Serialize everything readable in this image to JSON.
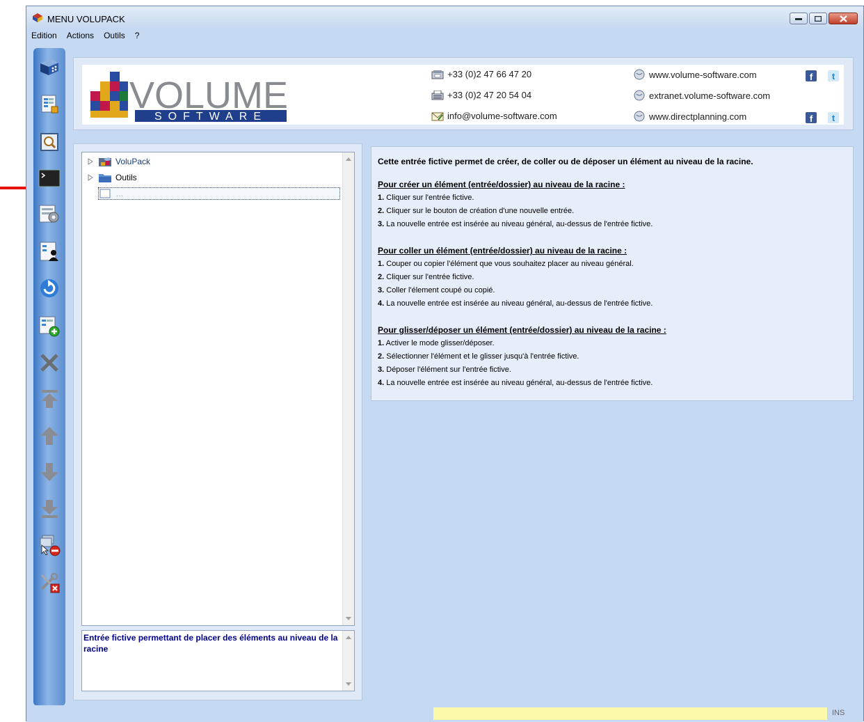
{
  "window": {
    "title": "MENU VOLUPACK"
  },
  "menu": [
    "Edition",
    "Actions",
    "Outils",
    "?"
  ],
  "toolbar_icons": [
    "volupack-icon",
    "form-lock-icon",
    "search-preview-icon",
    "console-icon",
    "settings-panel-icon",
    "user-tree-icon",
    "refresh-icon",
    "add-entry-icon",
    "delete-icon",
    "move-top-icon",
    "move-up-icon",
    "move-down-icon",
    "move-bottom-icon",
    "drag-drop-off-icon",
    "tools-close-icon"
  ],
  "logo": {
    "word": "VOLUME",
    "sub": "SOFTWARE"
  },
  "contacts": {
    "phone": "+33 (0)2 47 66 47 20",
    "fax": "+33 (0)2 47 20 54 04",
    "email": "info@volume-software.com",
    "web1": "www.volume-software.com",
    "web2": "extranet.volume-software.com",
    "web3": "www.directplanning.com"
  },
  "tree": {
    "items": [
      {
        "label": "VoluPack"
      },
      {
        "label": "Outils"
      },
      {
        "label": "..."
      }
    ]
  },
  "description": "Entrée fictive permettant de placer des éléments au niveau de la racine",
  "info": {
    "intro": "Cette entrée fictive permet de créer, de coller ou de déposer un élément au niveau de la racine.",
    "sections": [
      {
        "title": "Pour créer un élément (entrée/dossier) au niveau de la racine :",
        "steps": [
          {
            "num": "1.",
            "text": " Cliquer sur l'entrée fictive."
          },
          {
            "num": "2.",
            "text": " Cliquer sur le bouton de création d'une nouvelle entrée."
          },
          {
            "num": "3.",
            "text": " La nouvelle entrée est insérée au niveau général, au-dessus de l'entrée fictive."
          }
        ]
      },
      {
        "title": "Pour coller un élément (entrée/dossier) au niveau de la racine :",
        "steps": [
          {
            "num": "1.",
            "text": " Couper ou copier l'élément que vous souhaitez placer au niveau général."
          },
          {
            "num": "2.",
            "text": " Cliquer sur l'entrée fictive."
          },
          {
            "num": "3.",
            "text": " Coller l'élement coupé ou copié."
          },
          {
            "num": "4.",
            "text": " La nouvelle entrée est insérée au niveau général, au-dessus de l'entrée fictive."
          }
        ]
      },
      {
        "title": "Pour glisser/déposer un élément (entrée/dossier) au niveau de la racine :",
        "steps": [
          {
            "num": "1.",
            "text": " Activer le mode glisser/déposer."
          },
          {
            "num": "2.",
            "text": " Sélectionner l'élément et le glisser jusqu'à l'entrée fictive."
          },
          {
            "num": "3.",
            "text": " Déposer l'élément sur l'entrée fictive."
          },
          {
            "num": "4.",
            "text": " La nouvelle entrée est insérée au niveau général, au-dessus de l'entrée fictive."
          }
        ]
      }
    ]
  },
  "status": {
    "ins": "INS"
  }
}
